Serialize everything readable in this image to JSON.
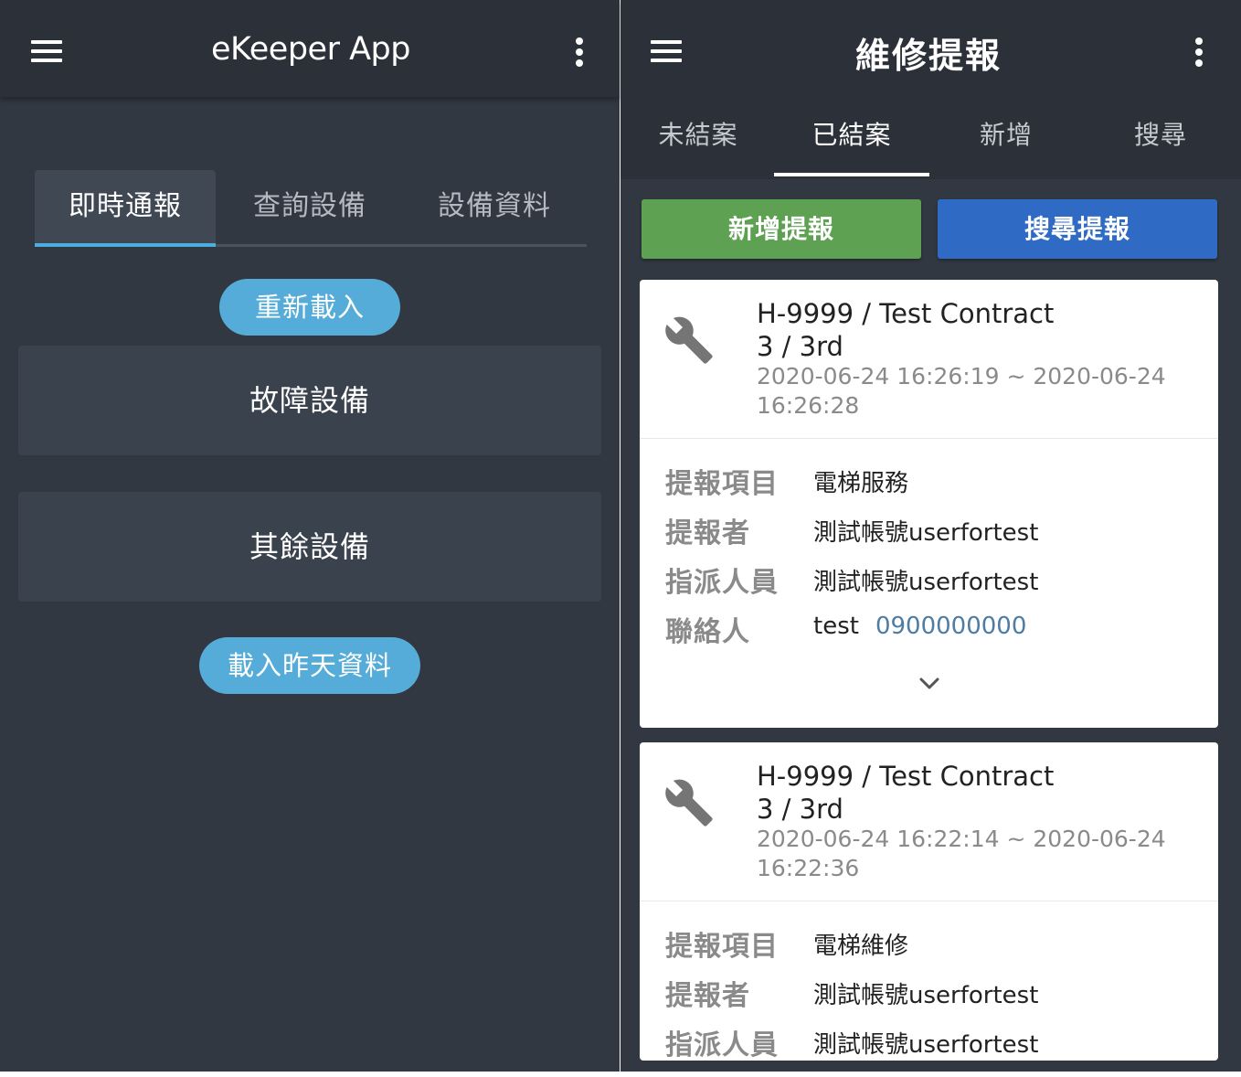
{
  "left": {
    "app_title": "eKeeper App",
    "tabs": [
      {
        "label": "即時通報"
      },
      {
        "label": "查詢設備"
      },
      {
        "label": "設備資料"
      }
    ],
    "reload_label": "重新載入",
    "sections": [
      {
        "label": "故障設備"
      },
      {
        "label": "其餘設備"
      }
    ],
    "load_yesterday_label": "載入昨天資料"
  },
  "right": {
    "page_title": "維修提報",
    "tabs": [
      {
        "label": "未結案"
      },
      {
        "label": "已結案"
      },
      {
        "label": "新增"
      },
      {
        "label": "搜尋"
      }
    ],
    "active_tab": "已結案",
    "new_report_label": "新增提報",
    "search_report_label": "搜尋提報",
    "field_labels": {
      "item": "提報項目",
      "reporter": "提報者",
      "assignee": "指派人員",
      "contact": "聯絡人"
    },
    "reports": [
      {
        "contract": "H-9999 / Test Contract",
        "floor": "3 / 3rd",
        "time_range": "2020-06-24 16:26:19 ~ 2020-06-24 16:26:28",
        "item": "電梯服務",
        "reporter": "測試帳號userfortest",
        "assignee": "測試帳號userfortest",
        "contact_name": "test",
        "contact_phone": "0900000000"
      },
      {
        "contract": "H-9999 / Test Contract",
        "floor": "3 / 3rd",
        "time_range": "2020-06-24 16:22:14 ~ 2020-06-24 16:22:36",
        "item": "電梯維修",
        "reporter": "測試帳號userfortest",
        "assignee": "測試帳號userfortest"
      }
    ]
  },
  "colors": {
    "background": "#313842",
    "appbar": "#2c3139",
    "accent_blue": "#56acd8",
    "tab_indicator": "#4aaee0",
    "new_button": "#5ea152",
    "search_button": "#2f6bc4",
    "phone_link": "#4f7ca3"
  },
  "icons": [
    "menu-icon",
    "more-vert-icon",
    "wrench-icon",
    "chevron-down-icon"
  ]
}
